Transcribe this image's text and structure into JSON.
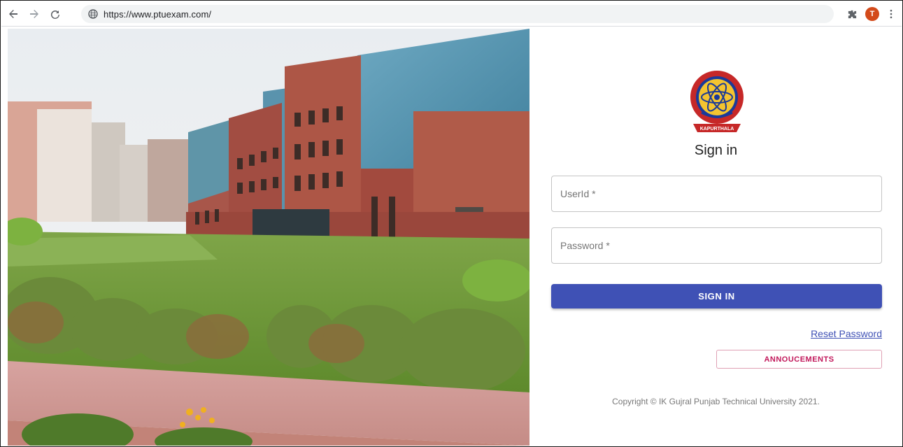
{
  "browser": {
    "url": "https://www.ptuexam.com/",
    "avatar_letter": "T"
  },
  "login": {
    "title": "Sign in",
    "userid_placeholder": "UserId *",
    "password_placeholder": "Password *",
    "signin_label": "SIGN IN",
    "reset_label": "Reset Password",
    "announce_label": "ANNOUCEMENTS",
    "copyright": "Copyright © IK Gujral Punjab Technical University 2021.",
    "logo_text": "KAPURTHALA"
  },
  "colors": {
    "primary": "#3f51b5",
    "secondary": "#c2185b"
  }
}
